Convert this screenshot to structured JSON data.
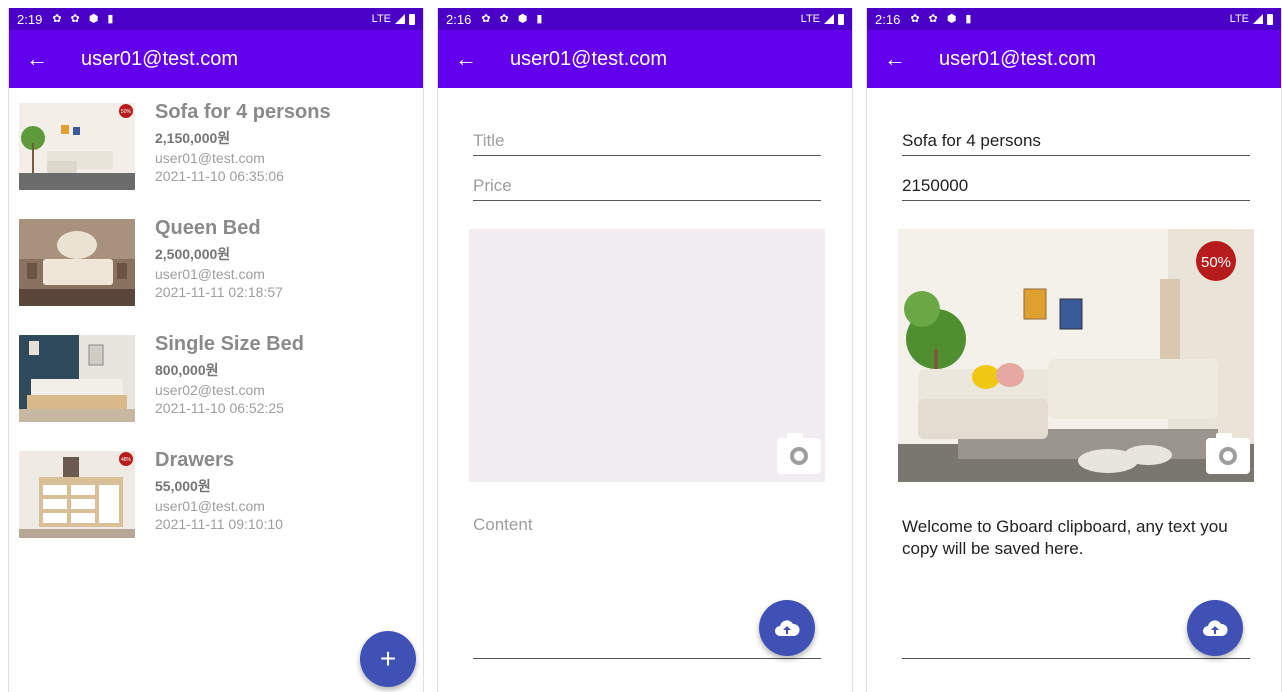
{
  "screen1": {
    "status": {
      "time": "2:19",
      "network": "LTE"
    },
    "appbar": {
      "title": "user01@test.com"
    },
    "items": [
      {
        "title": "Sofa for 4 persons",
        "price": "2,150,000원",
        "user": "user01@test.com",
        "date": "2021-11-10 06:35:06",
        "badge": "50%"
      },
      {
        "title": "Queen Bed",
        "price": "2,500,000원",
        "user": "user01@test.com",
        "date": "2021-11-11 02:18:57"
      },
      {
        "title": "Single Size Bed",
        "price": "800,000원",
        "user": "user02@test.com",
        "date": "2021-11-10 06:52:25"
      },
      {
        "title": "Drawers",
        "price": "55,000원",
        "user": "user01@test.com",
        "date": "2021-11-11 09:10:10",
        "badge": "48%"
      }
    ],
    "fab": {
      "label": "+"
    }
  },
  "screen2": {
    "status": {
      "time": "2:16",
      "network": "LTE"
    },
    "appbar": {
      "title": "user01@test.com"
    },
    "title_placeholder": "Title",
    "price_placeholder": "Price",
    "content_placeholder": "Content"
  },
  "screen3": {
    "status": {
      "time": "2:16",
      "network": "LTE"
    },
    "appbar": {
      "title": "user01@test.com"
    },
    "title_value": "Sofa for 4 persons",
    "price_value": "2150000",
    "badge": "50%",
    "content_value": "Welcome to Gboard clipboard, any text you copy will be saved here."
  },
  "colors": {
    "status_bar": "#4a00c7",
    "app_bar": "#6200ee",
    "fab": "#3f51b5"
  }
}
